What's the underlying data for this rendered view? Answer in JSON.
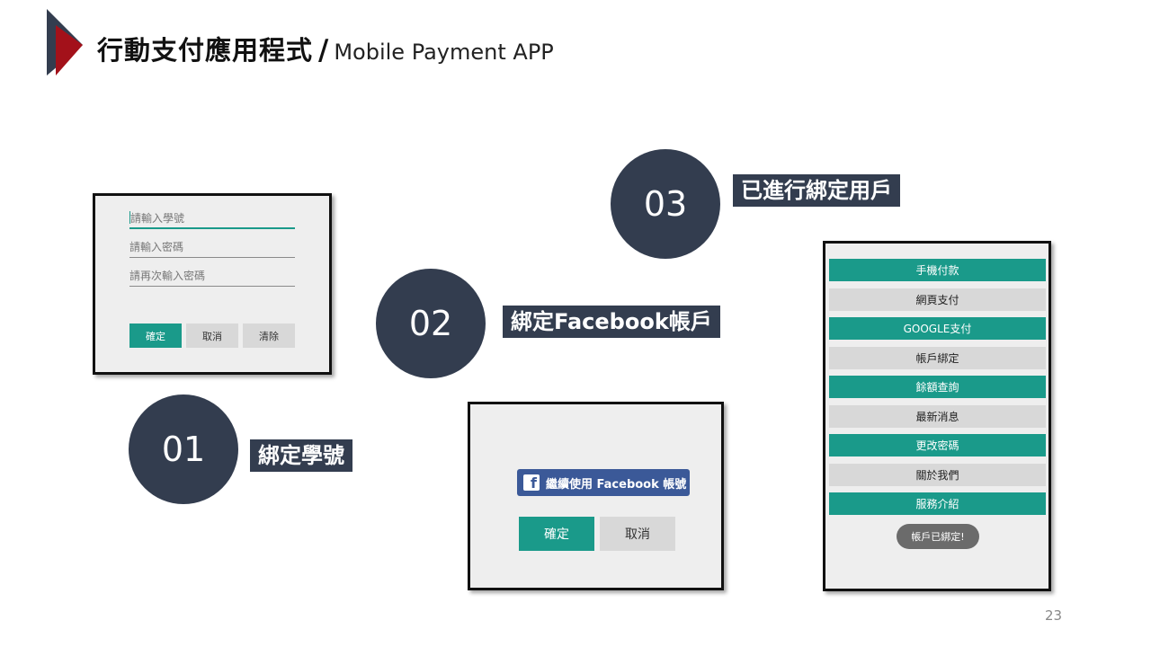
{
  "header": {
    "title_zh": "行動支付應用程式",
    "separator": "/",
    "title_en": "Mobile Payment APP"
  },
  "steps": [
    {
      "number": "01",
      "label": "綁定學號"
    },
    {
      "number": "02",
      "label": "綁定Facebook帳戶"
    },
    {
      "number": "03",
      "label": "已進行綁定用戶"
    }
  ],
  "login_form": {
    "student_id_placeholder": "請輸入學號",
    "password_placeholder": "請輸入密碼",
    "password_confirm_placeholder": "請再次輸入密碼",
    "confirm_label": "確定",
    "cancel_label": "取消",
    "clear_label": "清除"
  },
  "facebook_screen": {
    "fb_glyph": "f",
    "fb_button_label": "繼續使用 Facebook 帳號",
    "confirm_label": "確定",
    "cancel_label": "取消"
  },
  "menu_screen": {
    "items": [
      {
        "label": "手機付款",
        "style": "teal"
      },
      {
        "label": "網頁支付",
        "style": "grey"
      },
      {
        "label": "GOOGLE支付",
        "style": "teal"
      },
      {
        "label": "帳戶綁定",
        "style": "grey"
      },
      {
        "label": "餘額查詢",
        "style": "teal"
      },
      {
        "label": "最新消息",
        "style": "grey"
      },
      {
        "label": "更改密碼",
        "style": "teal"
      },
      {
        "label": "關於我們",
        "style": "grey"
      },
      {
        "label": "服務介紹",
        "style": "teal"
      }
    ],
    "toast": "帳戶已綁定!"
  },
  "colors": {
    "accent_teal": "#1a9a8a",
    "dark_navy": "#333d4f",
    "logo_red": "#a3111a",
    "facebook_blue": "#3b5998"
  },
  "page_number": "23"
}
